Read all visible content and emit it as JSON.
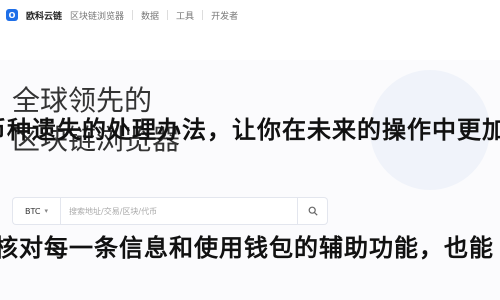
{
  "nav": {
    "brand": "欧科云链",
    "items": [
      "区块链浏览器",
      "数据",
      "工具",
      "开发者"
    ]
  },
  "hero": {
    "headline_line1": "全球领先的",
    "headline_line2": "区块链浏览器"
  },
  "search": {
    "coin": "BTC",
    "placeholder": "搜索地址/交易/区块/代币"
  },
  "overlay": {
    "line1": "币种遗失的处理办法，让你在未来的操作中更加",
    "line2": "核对每一条信息和使用钱包的辅助功能，也能"
  }
}
